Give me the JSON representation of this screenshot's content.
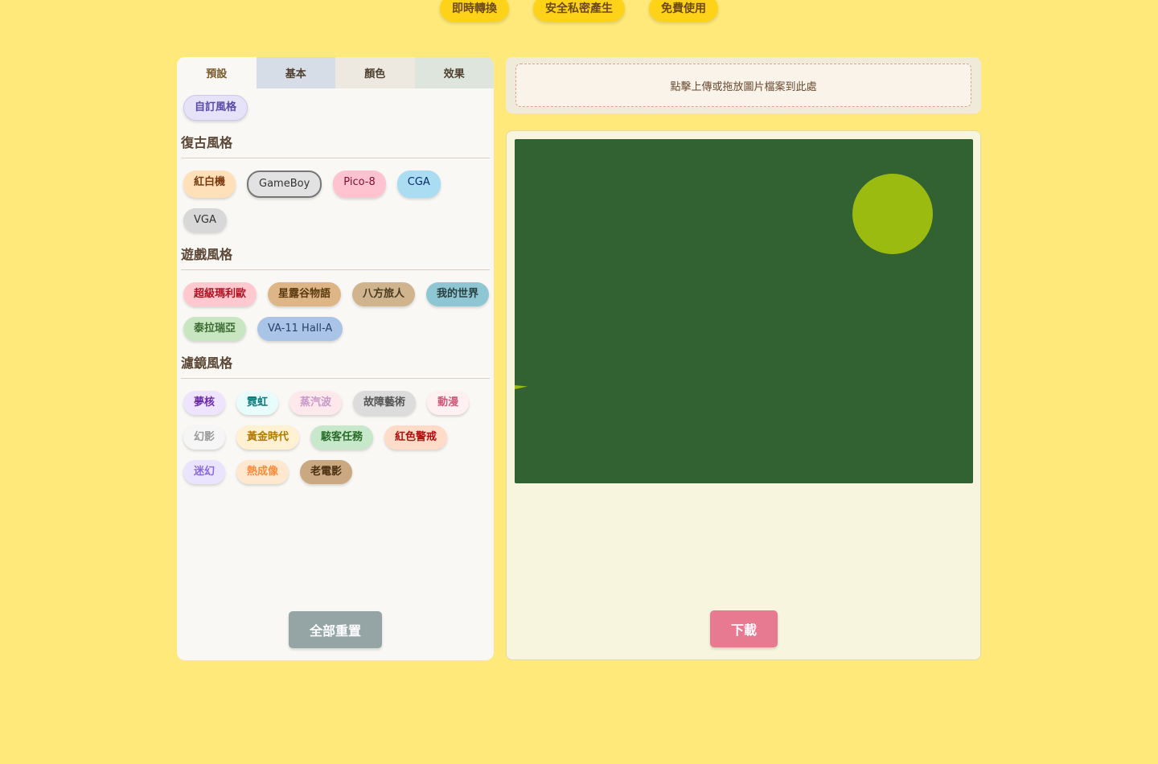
{
  "badges": [
    "即時轉換",
    "安全私密產生",
    "免費使用"
  ],
  "tabs": [
    "預設",
    "基本",
    "顏色",
    "效果"
  ],
  "custom_style": "自訂風格",
  "sections": {
    "retro": {
      "title": "復古風格",
      "chips": [
        "紅白機",
        "GameBoy",
        "Pico-8",
        "CGA",
        "VGA"
      ]
    },
    "game": {
      "title": "遊戲風格",
      "chips": [
        "超級瑪利歐",
        "星露谷物語",
        "八方旅人",
        "我的世界",
        "泰拉瑞亞",
        "VA-11 Hall-A"
      ]
    },
    "filter": {
      "title": "濾鏡風格",
      "chips": [
        "夢核",
        "霓虹",
        "蒸汽波",
        "故障藝術",
        "動漫",
        "幻影",
        "黃金時代",
        "駭客任務",
        "紅色警戒",
        "迷幻",
        "熱成像",
        "老電影"
      ]
    }
  },
  "reset_label": "全部重置",
  "upload_text": "點擊上傳或拖放圖片檔案到此處",
  "download_label": "下載",
  "selected_chip": "GameBoy",
  "colors": {
    "background": "#ffe97a",
    "badge": "#ffd21a",
    "preview_dark": "#326231",
    "preview_light": "#9bbb10",
    "download": "#e77a90",
    "reset": "#95a5a6"
  }
}
